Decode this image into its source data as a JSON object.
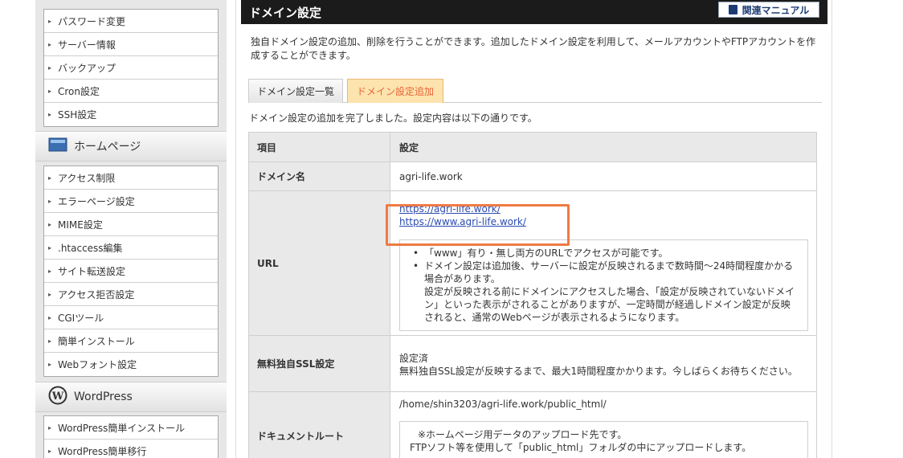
{
  "sidebar": {
    "group1": [
      {
        "label": "パスワード変更"
      },
      {
        "label": "サーバー情報"
      },
      {
        "label": "バックアップ"
      },
      {
        "label": "Cron設定"
      },
      {
        "label": "SSH設定"
      }
    ],
    "homepage_header": "ホームページ",
    "group2": [
      {
        "label": "アクセス制限"
      },
      {
        "label": "エラーページ設定"
      },
      {
        "label": "MIME設定"
      },
      {
        "label": ".htaccess編集"
      },
      {
        "label": "サイト転送設定"
      },
      {
        "label": "アクセス拒否設定"
      },
      {
        "label": "CGIツール"
      },
      {
        "label": "簡単インストール"
      },
      {
        "label": "Webフォント設定"
      }
    ],
    "wordpress_header": "WordPress",
    "group3": [
      {
        "label": "WordPress簡単インストール"
      },
      {
        "label": "WordPress簡単移行"
      }
    ]
  },
  "main": {
    "title": "ドメイン設定",
    "manual_label": "関連マニュアル",
    "intro": "独自ドメイン設定の追加、削除を行うことができます。追加したドメイン設定を利用して、メールアカウントやFTPアカウントを作成することができます。",
    "tabs": [
      {
        "label": "ドメイン設定一覧"
      },
      {
        "label": "ドメイン設定追加"
      }
    ],
    "done_message": "ドメイン設定の追加を完了しました。設定内容は以下の通りです。",
    "table": {
      "col_item": "項目",
      "col_setting": "設定",
      "domain_label": "ドメイン名",
      "domain_value": "agri-life.work",
      "url_label": "URL",
      "url1": "https://agri-life.work/",
      "url2": "https://www.agri-life.work/",
      "url_note1": "「www」有り・無し両方のURLでアクセスが可能です。",
      "url_note2": "ドメイン設定は追加後、サーバーに設定が反映されるまで数時間～24時間程度かかる場合があります。",
      "url_note3": "設定が反映される前にドメインにアクセスした場合、「設定が反映されていないドメイン」といった表示がされることがありますが、一定時間が経過しドメイン設定が反映されると、通常のWebページが表示されるようになります。",
      "ssl_label": "無料独自SSL設定",
      "ssl_status": "設定済",
      "ssl_note": "無料独自SSL設定が反映するまで、最大1時間程度かかります。今しばらくお待ちください。",
      "docroot_label": "ドキュメントルート",
      "docroot_value": "/home/shin3203/agri-life.work/public_html/",
      "docroot_note1": "※ホームページ用データのアップロード先です。",
      "docroot_note2": "FTPソフト等を使用して「public_html」フォルダの中にアップロードします。"
    }
  },
  "colors": {
    "highlight_border": "#ef7a43",
    "active_tab_bg": "#fde3ae",
    "active_tab_text": "#e8663a",
    "link": "#2a4bb0",
    "titlebar": "#1b1b1b"
  }
}
